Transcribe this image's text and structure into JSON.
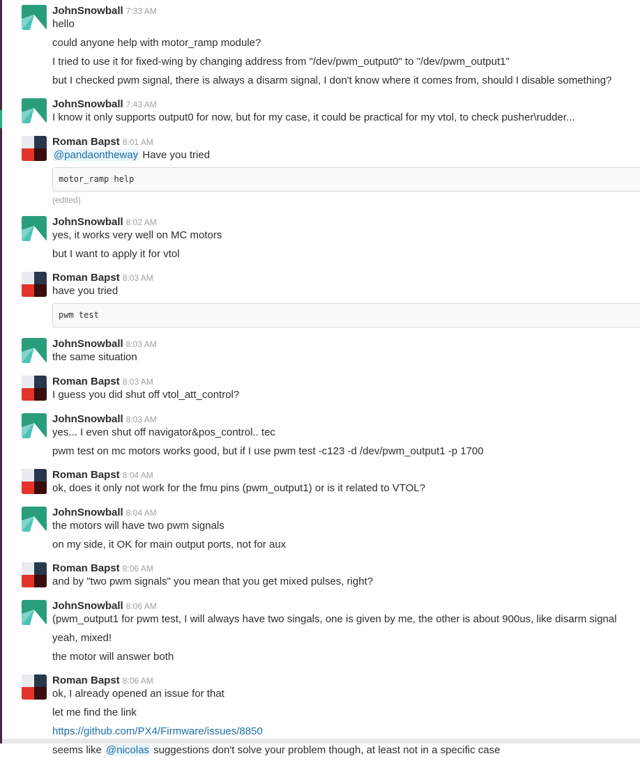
{
  "users": {
    "john": {
      "name": "JohnSnowball",
      "avatar_icon": "teal-geometric-avatar-icon"
    },
    "roman": {
      "name": "Roman Bapst",
      "avatar_icon": "red-dark-geometric-avatar-icon"
    }
  },
  "messages": [
    {
      "author": "JohnSnowball",
      "time": "7:33 AM",
      "lines": [
        "hello",
        "could anyone help with motor_ramp module?",
        "I tried to use it for fixed-wing by changing address from \"/dev/pwm_output0\" to \"/dev/pwm_output1\"",
        "but I checked pwm signal, there is always a disarm signal, I don't know where it comes from, should I disable something?"
      ]
    },
    {
      "author": "JohnSnowball",
      "time": "7:43 AM",
      "lines": [
        "I know it only supports output0 for now, but for my case, it could be practical for my vtol, to check pusher\\rudder..."
      ]
    },
    {
      "author": "Roman Bapst",
      "time": "8:01 AM",
      "mention": "@pandaontheway",
      "mention_text": " Have you tried",
      "code": "motor_ramp help",
      "edited": "(edited)"
    },
    {
      "author": "JohnSnowball",
      "time": "8:02 AM",
      "lines": [
        "yes, it works very well on MC motors",
        "but I want to apply it for vtol"
      ]
    },
    {
      "author": "Roman Bapst",
      "time": "8:03 AM",
      "lines": [
        "have you tried"
      ],
      "code": "pwm test"
    },
    {
      "author": "JohnSnowball",
      "time": "8:03 AM",
      "lines": [
        "the same situation"
      ]
    },
    {
      "author": "Roman Bapst",
      "time": "8:03 AM",
      "lines": [
        "I guess you did shut off vtol_att_control?"
      ]
    },
    {
      "author": "JohnSnowball",
      "time": "8:03 AM",
      "lines": [
        "yes... I even shut off navigator&pos_control.. tec",
        "pwm test on mc motors works good, but if I use pwm test -c123 -d /dev/pwm_output1 -p 1700"
      ]
    },
    {
      "author": "Roman Bapst",
      "time": "8:04 AM",
      "lines": [
        "ok, does it only not work for the fmu pins (pwm_output1) or is it related to VTOL?"
      ]
    },
    {
      "author": "JohnSnowball",
      "time": "8:04 AM",
      "lines": [
        "the motors will have two pwm signals",
        "on my side, it OK for main output ports, not for aux"
      ]
    },
    {
      "author": "Roman Bapst",
      "time": "8:06 AM",
      "lines": [
        "and by \"two pwm signals\" you mean that you get mixed pulses, right?"
      ]
    },
    {
      "author": "JohnSnowball",
      "time": "8:06 AM",
      "lines": [
        "(pwm_output1 for pwm test, I will always have two singals, one is given by me, the other is about 900us, like disarm signal",
        "yeah, mixed!",
        "the motor will answer both"
      ]
    },
    {
      "author": "Roman Bapst",
      "time": "8:06 AM",
      "lines": [
        "ok, I already opened an issue for that",
        "let me find the link"
      ],
      "link": "https://github.com/PX4/Firmware/issues/8850",
      "final_prefix": "seems like ",
      "final_mention": "@nicolas",
      "final_suffix": " suggestions don't solve your problem though, at least not in a specific case"
    }
  ]
}
